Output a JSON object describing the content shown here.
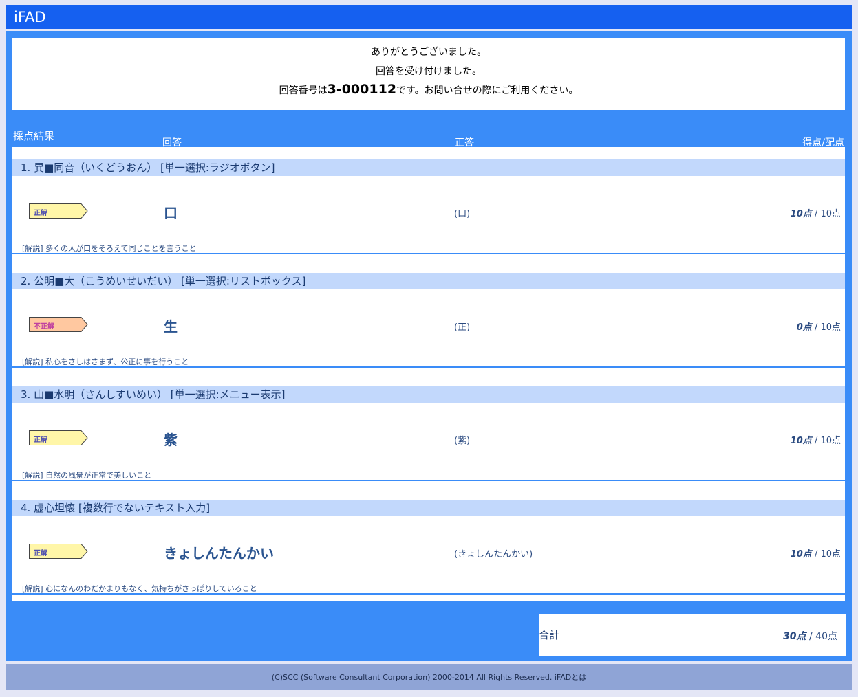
{
  "app": {
    "title": "iFAD"
  },
  "message": {
    "line1": "ありがとうございました。",
    "line2": "回答を受け付けました。",
    "line3_prefix": "回答番号は",
    "answer_number": "3-000112",
    "line3_suffix": "です。お問い合せの際にご利用ください。"
  },
  "headers": {
    "section": "採点結果",
    "answer": "回答",
    "correct": "正答",
    "score": "得点/配点"
  },
  "questions": [
    {
      "title": "1. 異■同音（いくどうおん） [単一選択:ラジオボタン]",
      "result": "正解",
      "answer": "口",
      "correct": "(口)",
      "score": "10点",
      "max": "10点",
      "explanation": "[解説] 多くの人が口をそろえて同じことを言うこと"
    },
    {
      "title": "2. 公明■大（こうめいせいだい） [単一選択:リストボックス]",
      "result": "不正解",
      "answer": "生",
      "correct": "(正)",
      "score": "0点",
      "max": "10点",
      "explanation": "[解説] 私心をさしはさまず、公正に事を行うこと"
    },
    {
      "title": "3. 山■水明（さんしすいめい） [単一選択:メニュー表示]",
      "result": "正解",
      "answer": "紫",
      "correct": "(紫)",
      "score": "10点",
      "max": "10点",
      "explanation": "[解説] 自然の風景が正常で美しいこと"
    },
    {
      "title": "4. 虚心坦懐 [複数行でないテキスト入力]",
      "result": "正解",
      "answer": "きょしんたんかい",
      "correct": "(きょしんたんかい)",
      "score": "10点",
      "max": "10点",
      "explanation": "[解説] 心になんのわだかまりもなく、気持ちがさっぱりしていること"
    }
  ],
  "total": {
    "label": "合計",
    "score": "30点",
    "max": "40点"
  },
  "footer": {
    "copyright": "(C)SCC (Software Consultant Corporation) 2000-2014 All Rights Reserved.",
    "link": "iFADとは"
  },
  "colors": {
    "header": "#1560f0",
    "panel": "#3a8cf8",
    "question_bar": "#c2d8fc",
    "badge_correct": "#fff6a8",
    "badge_incorrect": "#ffc8a0"
  }
}
